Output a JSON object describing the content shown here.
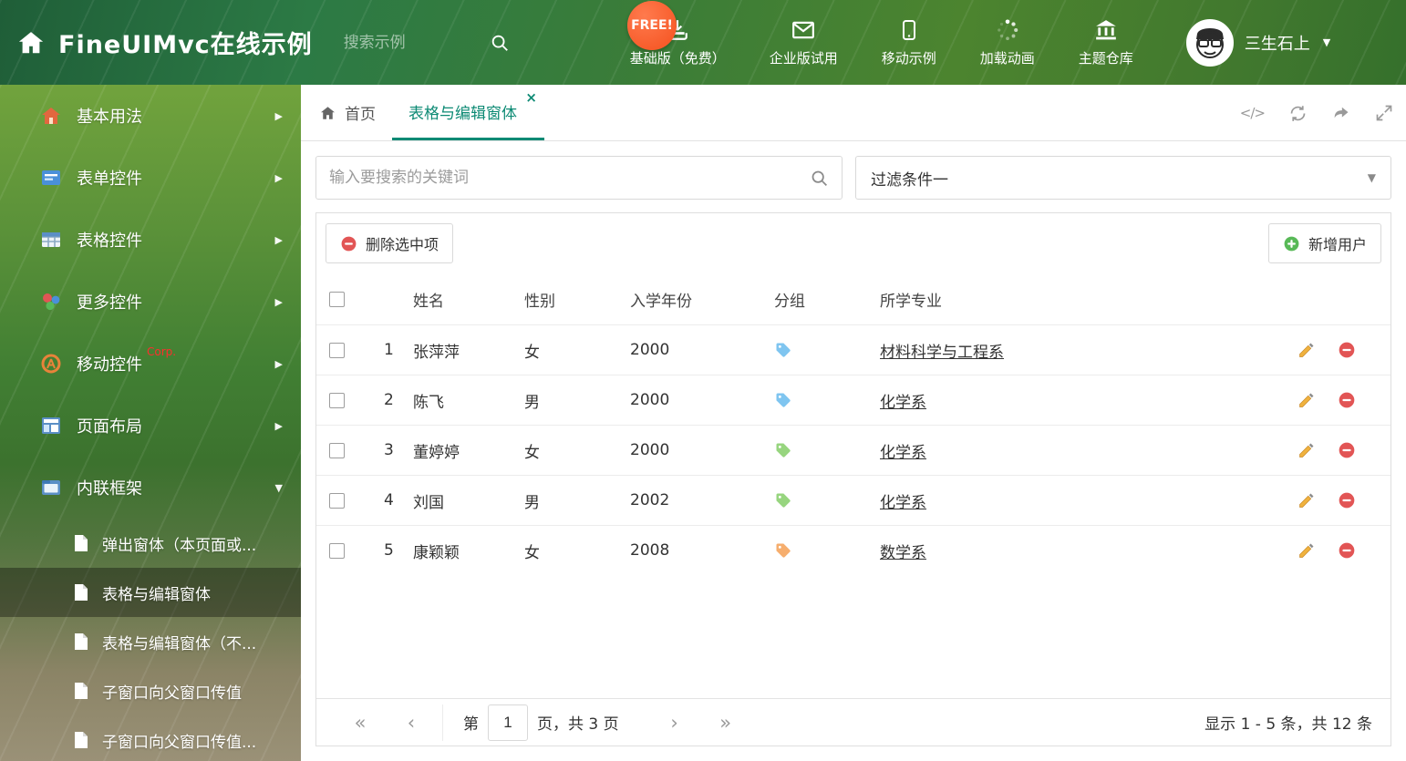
{
  "colors": {
    "accent": "#0d8a74",
    "header_green": "#2c7a45",
    "danger": "#e25555",
    "success": "#4aa94a",
    "free_badge_bg": "#f4511e"
  },
  "icons": {
    "caret_down": "▼",
    "arrow_right": "▶",
    "close": "×",
    "code": "</>",
    "chevron_double_left": "«",
    "chevron_left": "‹",
    "chevron_right": "›",
    "chevron_double_right": "»"
  },
  "header": {
    "title": "FineUIMvc在线示例",
    "search_placeholder": "搜索示例",
    "free_badge": "FREE!",
    "nav": [
      {
        "label": "基础版（免费）"
      },
      {
        "label": "企业版试用"
      },
      {
        "label": "移动示例"
      },
      {
        "label": "加载动画"
      },
      {
        "label": "主题仓库"
      }
    ],
    "user_name": "三生石上"
  },
  "sidebar": {
    "items": [
      {
        "label": "基本用法"
      },
      {
        "label": "表单控件"
      },
      {
        "label": "表格控件"
      },
      {
        "label": "更多控件"
      },
      {
        "label": "移动控件",
        "badge": "Corp."
      },
      {
        "label": "页面布局"
      },
      {
        "label": "内联框架"
      }
    ],
    "submenu": [
      {
        "label": "弹出窗体（本页面或..."
      },
      {
        "label": "表格与编辑窗体"
      },
      {
        "label": "表格与编辑窗体（不..."
      },
      {
        "label": "子窗口向父窗口传值"
      },
      {
        "label": "子窗口向父窗口传值..."
      }
    ]
  },
  "tabs": {
    "home": "首页",
    "active": "表格与编辑窗体"
  },
  "filters": {
    "search_placeholder": "输入要搜索的关键词",
    "filter_label": "过滤条件一"
  },
  "toolbar": {
    "delete_label": "删除选中项",
    "add_label": "新增用户"
  },
  "table": {
    "headers": {
      "name": "姓名",
      "gender": "性别",
      "year": "入学年份",
      "group": "分组",
      "major": "所学专业"
    },
    "rows": [
      {
        "num": "1",
        "name": "张萍萍",
        "gender": "女",
        "year": "2000",
        "tag_color": "#7fc5f0",
        "major": "材料科学与工程系"
      },
      {
        "num": "2",
        "name": "陈飞",
        "gender": "男",
        "year": "2000",
        "tag_color": "#7fc5f0",
        "major": "化学系"
      },
      {
        "num": "3",
        "name": "董婷婷",
        "gender": "女",
        "year": "2000",
        "tag_color": "#97d57f",
        "major": "化学系"
      },
      {
        "num": "4",
        "name": "刘国",
        "gender": "男",
        "year": "2002",
        "tag_color": "#97d57f",
        "major": "化学系"
      },
      {
        "num": "5",
        "name": "康颖颖",
        "gender": "女",
        "year": "2008",
        "tag_color": "#f6ae6e",
        "major": "数学系"
      }
    ]
  },
  "pagination": {
    "page_prefix": "第",
    "page_value": "1",
    "page_suffix": "页，共 3 页",
    "summary": "显示 1 - 5 条，共 12 条"
  }
}
